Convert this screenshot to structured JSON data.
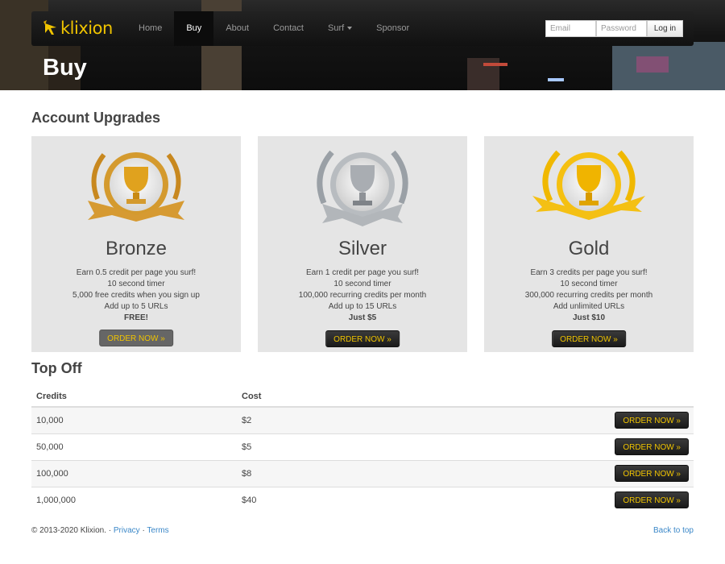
{
  "brand": {
    "name": "klixion",
    "accent": "#f0c400"
  },
  "nav": {
    "items": [
      {
        "label": "Home"
      },
      {
        "label": "Buy",
        "active": true
      },
      {
        "label": "About"
      },
      {
        "label": "Contact"
      },
      {
        "label": "Surf",
        "dropdown": true
      },
      {
        "label": "Sponsor"
      }
    ],
    "email_placeholder": "Email",
    "password_placeholder": "Password",
    "login_label": "Log in"
  },
  "page_title": "Buy",
  "upgrades": {
    "heading": "Account Upgrades",
    "plans": [
      {
        "name": "Bronze",
        "icon": "bronze-trophy-icon",
        "lines": [
          "Earn 0.5 credit per page you surf!",
          "10 second timer",
          "5,000 free credits when you sign up",
          "Add up to 5 URLs"
        ],
        "price": "FREE!",
        "button": "ORDER NOW »"
      },
      {
        "name": "Silver",
        "icon": "silver-trophy-icon",
        "lines": [
          "Earn 1 credit per page you surf!",
          "10 second timer",
          "100,000 recurring credits per month",
          "Add up to 15 URLs"
        ],
        "price": "Just $5",
        "button": "ORDER NOW »"
      },
      {
        "name": "Gold",
        "icon": "gold-trophy-icon",
        "lines": [
          "Earn 3 credits per page you surf!",
          "10 second timer",
          "300,000 recurring credits per month",
          "Add unlimited URLs"
        ],
        "price": "Just $10",
        "button": "ORDER NOW »"
      }
    ]
  },
  "topoff": {
    "heading": "Top Off",
    "columns": [
      "Credits",
      "Cost"
    ],
    "rows": [
      {
        "credits": "10,000",
        "cost": "$2",
        "button": "ORDER NOW »"
      },
      {
        "credits": "50,000",
        "cost": "$5",
        "button": "ORDER NOW »"
      },
      {
        "credits": "100,000",
        "cost": "$8",
        "button": "ORDER NOW »"
      },
      {
        "credits": "1,000,000",
        "cost": "$40",
        "button": "ORDER NOW »"
      }
    ]
  },
  "footer": {
    "copyright": "© 2013-2020 Klixion. ·",
    "privacy": "Privacy",
    "sep": "·",
    "terms": "Terms",
    "back_to_top": "Back to top"
  }
}
